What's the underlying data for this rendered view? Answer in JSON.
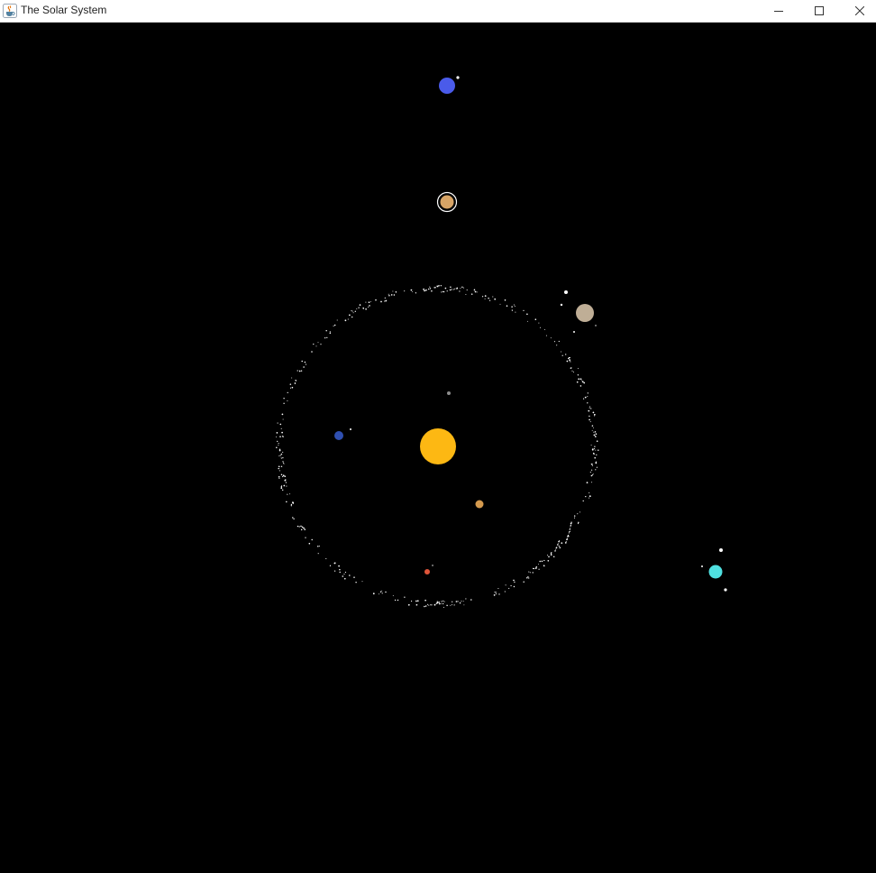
{
  "window": {
    "title": "The Solar System",
    "icon": "java-cup-icon",
    "controls": {
      "minimize": "minimize-icon",
      "maximize": "maximize-icon",
      "close": "close-icon"
    }
  },
  "scene": {
    "background": "#000000",
    "bodies": [
      {
        "name": "sun",
        "color": "#FDB813"
      },
      {
        "name": "mercury",
        "color": "#8C8C8C"
      },
      {
        "name": "venus",
        "color": "#D59A4E"
      },
      {
        "name": "earth",
        "color": "#2F4FB0"
      },
      {
        "name": "mars",
        "color": "#E0553A"
      },
      {
        "name": "jupiter",
        "color": "#BFAE96"
      },
      {
        "name": "saturn",
        "color": "#D7A466"
      },
      {
        "name": "uranus",
        "color": "#4FE0E0"
      },
      {
        "name": "neptune",
        "color": "#4A5BEA"
      }
    ],
    "asteroid_belt_color": "#FFFFFF"
  }
}
